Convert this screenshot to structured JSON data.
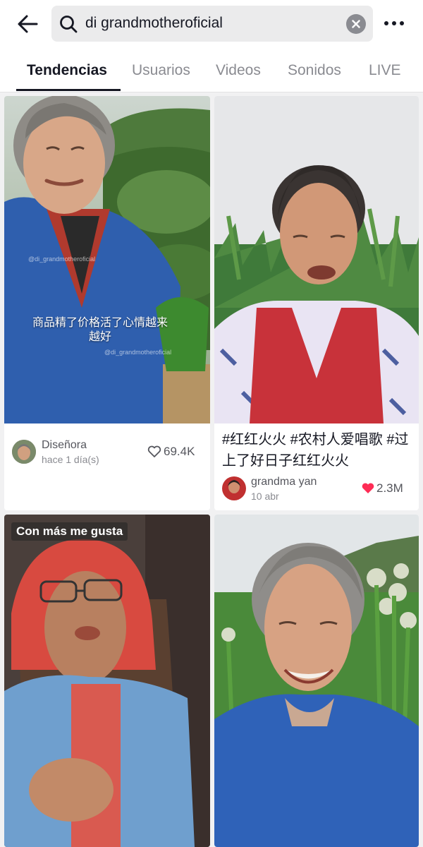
{
  "search": {
    "query": "di grandmotheroficial"
  },
  "tabs": [
    "Tendencias",
    "Usuarios",
    "Videos",
    "Sonidos",
    "LIVE"
  ],
  "cards": [
    {
      "overlay_caption": "商品精了价格活了心情越来越好",
      "watermark": "@di_grandmotheroficial",
      "author": "Diseñora",
      "date": "hace 1 día(s)",
      "likes": "69.4K"
    },
    {
      "caption": "#红红火火 #农村人爱唱歌 #过上了好日子红红火火",
      "author": "grandma yan",
      "date": "10 abr",
      "likes": "2.3M"
    },
    {
      "badge": "Con más me gusta"
    },
    {}
  ],
  "colors": {
    "accent": "#fe2c55",
    "tab_active": "#161823",
    "tab_inactive": "#8a8b91"
  }
}
